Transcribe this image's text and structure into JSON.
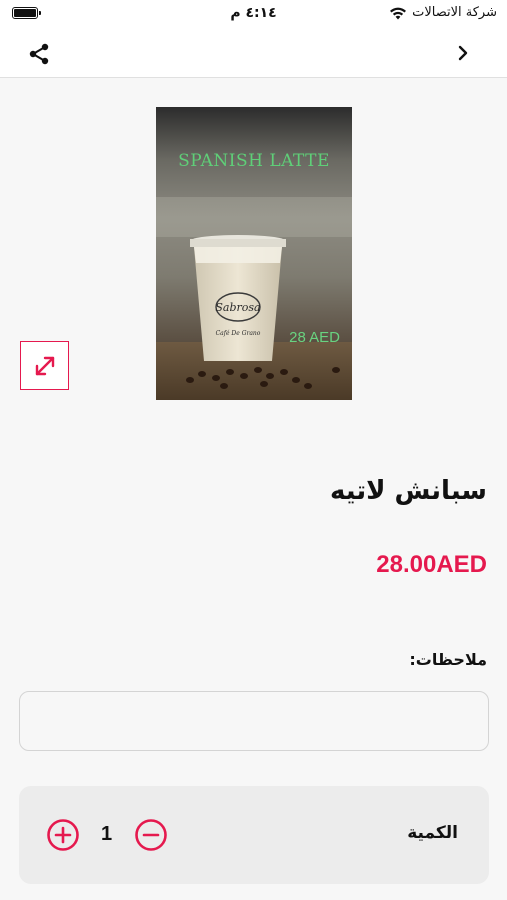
{
  "status_bar": {
    "carrier": "شركة الاتصالات",
    "time": "٤:١٤ م",
    "icons": [
      "battery-icon",
      "wifi-icon"
    ]
  },
  "nav": {
    "icons": [
      "share-icon",
      "back-chevron-icon"
    ]
  },
  "product": {
    "image_overlay_title": "SPANISH LATTE",
    "image_overlay_price": "28 AED",
    "image_cup_logo_text": "Sabrosa",
    "image_cup_tagline": "Café De Grano",
    "name": "سبانش لاتيه",
    "price": "28.00AED"
  },
  "notes": {
    "label": "ملاحظات:",
    "value": "",
    "placeholder": ""
  },
  "quantity": {
    "label": "الكمية",
    "value": "1"
  },
  "colors": {
    "accent": "#e5194e",
    "background": "#f7f7f7",
    "card": "#ececec"
  }
}
